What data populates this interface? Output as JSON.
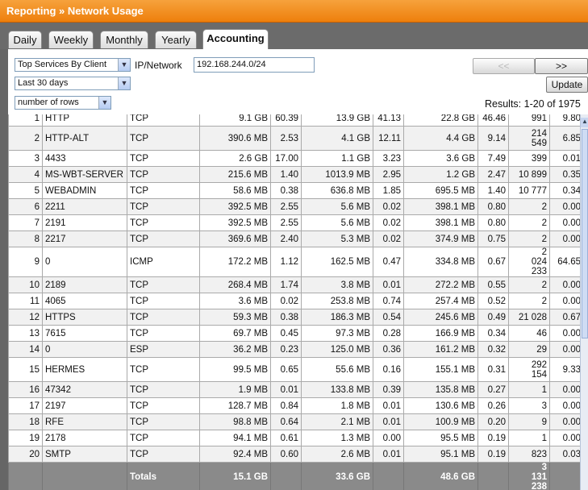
{
  "window": {
    "title": "Reporting » Network Usage"
  },
  "tabs": [
    {
      "label": "Daily",
      "active": false
    },
    {
      "label": "Weekly",
      "active": false
    },
    {
      "label": "Monthly",
      "active": false
    },
    {
      "label": "Yearly",
      "active": false
    },
    {
      "label": "Accounting",
      "active": true
    }
  ],
  "filters": {
    "report_type": "Top Services By Client",
    "ip_label": "IP/Network",
    "ip_value": "192.168.244.0/24",
    "period": "Last 30 days",
    "rows": "number of rows"
  },
  "controls": {
    "prev_label": "<<",
    "next_label": ">>",
    "update_label": "Update",
    "results_text": "Results: 1-20 of 1975"
  },
  "table": {
    "rows": [
      [
        "1",
        "HTTP",
        "TCP",
        "9.1 GB",
        "60.39",
        "13.9 GB",
        "41.13",
        "22.8 GB",
        "46.46",
        "991",
        "9.80"
      ],
      [
        "2",
        "HTTP-ALT",
        "TCP",
        "390.6 MB",
        "2.53",
        "4.1 GB",
        "12.11",
        "4.4 GB",
        "9.14",
        "214 549",
        "6.85"
      ],
      [
        "3",
        "4433",
        "TCP",
        "2.6 GB",
        "17.00",
        "1.1 GB",
        "3.23",
        "3.6 GB",
        "7.49",
        "399",
        "0.01"
      ],
      [
        "4",
        "MS-WBT-SERVER",
        "TCP",
        "215.6 MB",
        "1.40",
        "1013.9 MB",
        "2.95",
        "1.2 GB",
        "2.47",
        "10 899",
        "0.35"
      ],
      [
        "5",
        "WEBADMIN",
        "TCP",
        "58.6 MB",
        "0.38",
        "636.8 MB",
        "1.85",
        "695.5 MB",
        "1.40",
        "10 777",
        "0.34"
      ],
      [
        "6",
        "2211",
        "TCP",
        "392.5 MB",
        "2.55",
        "5.6 MB",
        "0.02",
        "398.1 MB",
        "0.80",
        "2",
        "0.00"
      ],
      [
        "7",
        "2191",
        "TCP",
        "392.5 MB",
        "2.55",
        "5.6 MB",
        "0.02",
        "398.1 MB",
        "0.80",
        "2",
        "0.00"
      ],
      [
        "8",
        "2217",
        "TCP",
        "369.6 MB",
        "2.40",
        "5.3 MB",
        "0.02",
        "374.9 MB",
        "0.75",
        "2",
        "0.00"
      ],
      [
        "9",
        "0",
        "ICMP",
        "172.2 MB",
        "1.12",
        "162.5 MB",
        "0.47",
        "334.8 MB",
        "0.67",
        "2 024 233",
        "64.65"
      ],
      [
        "10",
        "2189",
        "TCP",
        "268.4 MB",
        "1.74",
        "3.8 MB",
        "0.01",
        "272.2 MB",
        "0.55",
        "2",
        "0.00"
      ],
      [
        "11",
        "4065",
        "TCP",
        "3.6 MB",
        "0.02",
        "253.8 MB",
        "0.74",
        "257.4 MB",
        "0.52",
        "2",
        "0.00"
      ],
      [
        "12",
        "HTTPS",
        "TCP",
        "59.3 MB",
        "0.38",
        "186.3 MB",
        "0.54",
        "245.6 MB",
        "0.49",
        "21 028",
        "0.67"
      ],
      [
        "13",
        "7615",
        "TCP",
        "69.7 MB",
        "0.45",
        "97.3 MB",
        "0.28",
        "166.9 MB",
        "0.34",
        "46",
        "0.00"
      ],
      [
        "14",
        "0",
        "ESP",
        "36.2 MB",
        "0.23",
        "125.0 MB",
        "0.36",
        "161.2 MB",
        "0.32",
        "29",
        "0.00"
      ],
      [
        "15",
        "HERMES",
        "TCP",
        "99.5 MB",
        "0.65",
        "55.6 MB",
        "0.16",
        "155.1 MB",
        "0.31",
        "292 154",
        "9.33"
      ],
      [
        "16",
        "47342",
        "TCP",
        "1.9 MB",
        "0.01",
        "133.8 MB",
        "0.39",
        "135.8 MB",
        "0.27",
        "1",
        "0.00"
      ],
      [
        "17",
        "2197",
        "TCP",
        "128.7 MB",
        "0.84",
        "1.8 MB",
        "0.01",
        "130.6 MB",
        "0.26",
        "3",
        "0.00"
      ],
      [
        "18",
        "RFE",
        "TCP",
        "98.8 MB",
        "0.64",
        "2.1 MB",
        "0.01",
        "100.9 MB",
        "0.20",
        "9",
        "0.00"
      ],
      [
        "19",
        "2178",
        "TCP",
        "94.1 MB",
        "0.61",
        "1.3 MB",
        "0.00",
        "95.5 MB",
        "0.19",
        "1",
        "0.00"
      ],
      [
        "20",
        "SMTP",
        "TCP",
        "92.4 MB",
        "0.60",
        "2.6 MB",
        "0.01",
        "95.1 MB",
        "0.19",
        "823",
        "0.03"
      ]
    ],
    "totals": {
      "label": "Totals",
      "received": "15.1 GB",
      "sent": "33.6 GB",
      "total": "48.6 GB",
      "sessions": "3 131 238"
    }
  },
  "icons": {
    "dropdown": "chevron-down-icon",
    "scroll_up": "scroll-up-arrow-icon"
  },
  "colors": {
    "titlebar": "#ee7f0c",
    "tab_strip": "#6b6b6b",
    "totals_row": "#8a8a8a"
  }
}
